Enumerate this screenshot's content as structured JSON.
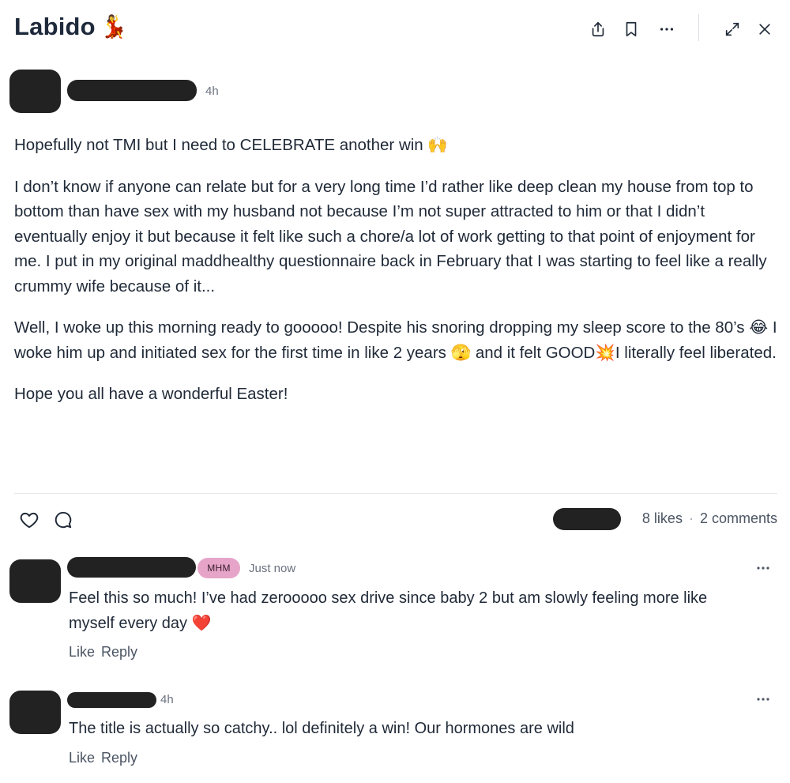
{
  "header": {
    "title": "Labido",
    "title_emoji": "💃",
    "icons": [
      "share-icon",
      "bookmark-icon",
      "more-icon",
      "expand-icon",
      "close-icon"
    ]
  },
  "post": {
    "time": "4h",
    "paragraphs": [
      "Hopefully not TMI but I need to CELEBRATE another win 🙌",
      "I don’t know if anyone can relate but for a very long time I’d rather like deep clean my house from top to bottom than have sex with my husband not because I’m not super attracted to him or that I didn’t eventually enjoy it but because it felt like such a chore/a lot of work getting to that point of enjoyment for me. I put in my original maddhealthy questionnaire back in February that I was starting to feel like a really crummy wife because of it...",
      "Well, I woke up this morning ready to gooooo! Despite his snoring dropping my sleep score to the 80’s 😂 I woke him up and initiated sex for the first time in like 2 years 🫣 and it felt GOOD💥I literally feel liberated.",
      "Hope you all have a wonderful Easter!"
    ]
  },
  "stats": {
    "likes": "8 likes",
    "separator": "·",
    "comments": "2 comments"
  },
  "comments": [
    {
      "badge": "MHM",
      "time": "Just now",
      "text": "Feel this so much! I’ve had zerooooo sex drive since baby 2 but am slowly feeling more like myself every day ❤️",
      "like_label": "Like",
      "reply_label": "Reply"
    },
    {
      "time": "4h",
      "text": "The title is actually so catchy.. lol definitely a win! Our hormones are wild",
      "like_label": "Like",
      "reply_label": "Reply"
    }
  ],
  "colors": {
    "title": "#1e2a3b",
    "text": "#1f2937",
    "muted": "#6b7280",
    "badge_bg": "#e6a4c8",
    "redaction": "#222222"
  }
}
